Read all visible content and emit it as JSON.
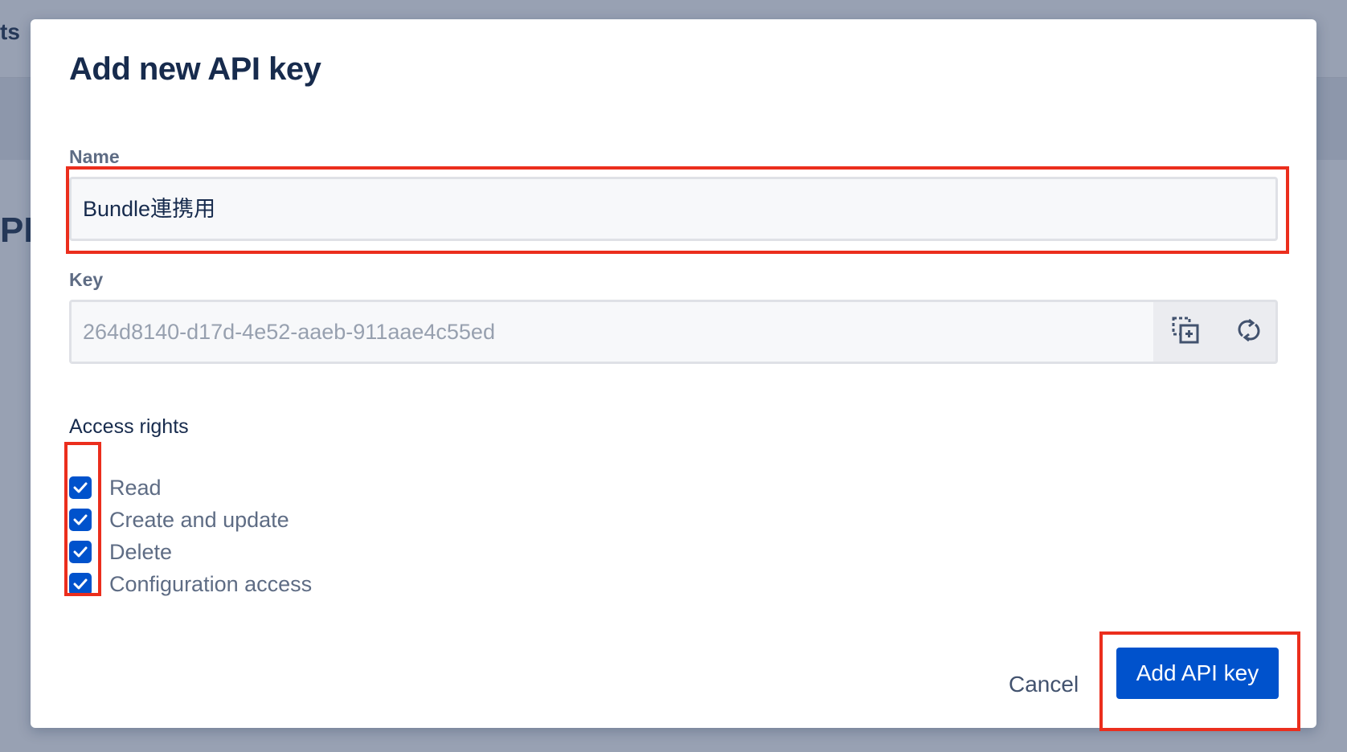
{
  "background": {
    "partial_text_top": "ts",
    "partial_text_heading": "PI"
  },
  "modal": {
    "title": "Add new API key",
    "name_field": {
      "label": "Name",
      "value": "Bundle連携用"
    },
    "key_field": {
      "label": "Key",
      "value": "264d8140-d17d-4e52-aaeb-911aae4c55ed",
      "copy_icon": "copy-icon",
      "refresh_icon": "refresh-icon"
    },
    "access_rights": {
      "label": "Access rights",
      "options": [
        {
          "label": "Read",
          "checked": true
        },
        {
          "label": "Create and update",
          "checked": true
        },
        {
          "label": "Delete",
          "checked": true
        },
        {
          "label": "Configuration access",
          "checked": true
        }
      ]
    },
    "actions": {
      "cancel_label": "Cancel",
      "submit_label": "Add API key"
    }
  },
  "colors": {
    "primary": "#0052cc",
    "highlight": "#eb2e1d",
    "overlay": "#98a1b3"
  }
}
